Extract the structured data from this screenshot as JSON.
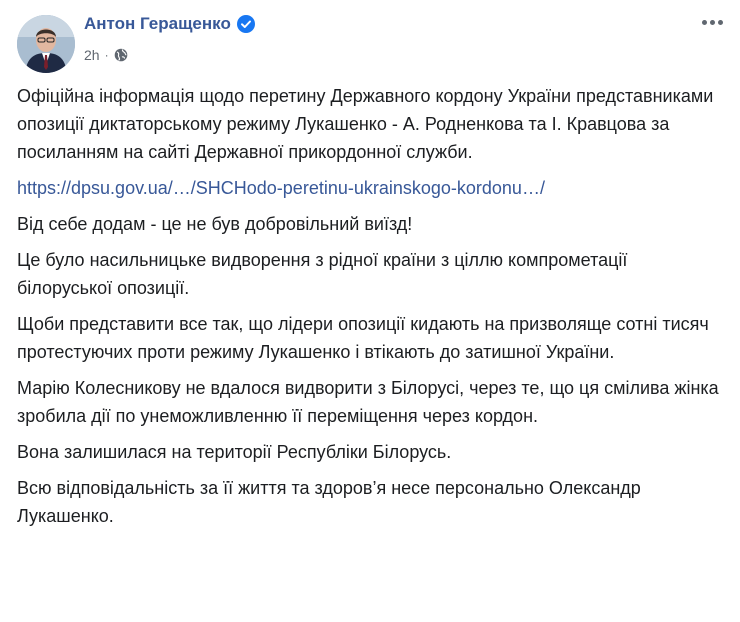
{
  "post": {
    "author": "Антон Геращенко",
    "verified_icon": "verified-badge-icon",
    "time": "2h",
    "separator": "·",
    "privacy_icon": "globe-icon",
    "more_icon": "more-options-icon",
    "paragraphs": [
      "Офіційна інформація щодо перетину Державного кордону України представниками опозиції диктаторському режиму Лукашенко - А. Родненкова та І. Кравцова за посиланням на сайті Державної прикордонної служби.",
      "https://dpsu.gov.ua/…/SHCHodo-peretinu-ukrainskogo-kordonu…/",
      "Від себе додам - це не був добровільний виїзд!",
      "Це було насильницьке видворення з рідної країни з ціллю компрометації білоруської опозиції.",
      "Щоби представити все так, що лідери опозиції кидають на призволяще сотні тисяч протестуючих проти режиму Лукашенко і втікають до затишної України.",
      "Марію Колесникову не вдалося видворити з Білорусі, через те, що ця смілива жінка зробила дії по унеможливленню її переміщення через кордон.",
      "Вона залишилася на території Республіки Білорусь.",
      "Всю відповідальність за її життя та здоров’я несе персонально Олександр Лукашенко."
    ]
  },
  "colors": {
    "link": "#385898",
    "text": "#1c1e21",
    "meta": "#606770",
    "verified": "#1877f2"
  }
}
